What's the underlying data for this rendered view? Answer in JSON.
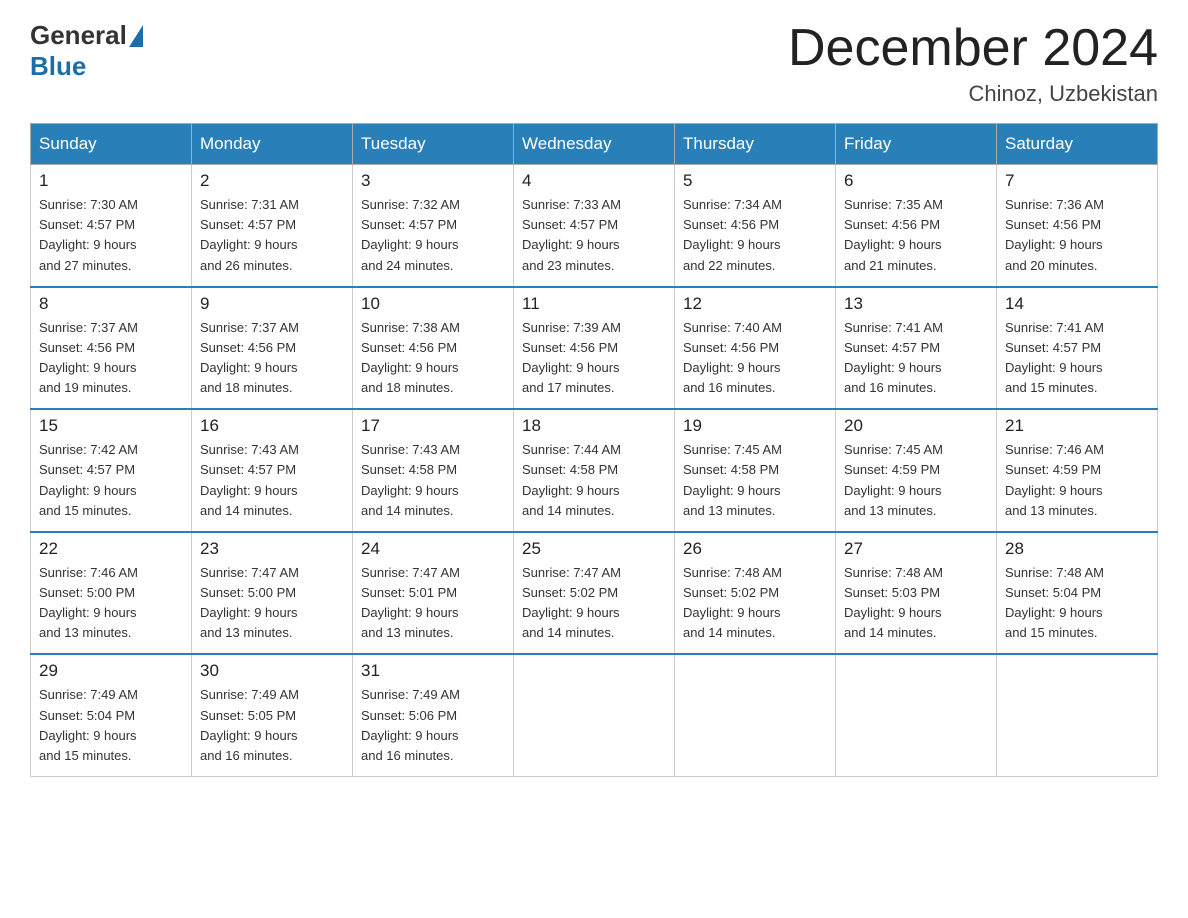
{
  "header": {
    "logo_general": "General",
    "logo_blue": "Blue",
    "title": "December 2024",
    "location": "Chinoz, Uzbekistan"
  },
  "days_of_week": [
    "Sunday",
    "Monday",
    "Tuesday",
    "Wednesday",
    "Thursday",
    "Friday",
    "Saturday"
  ],
  "weeks": [
    [
      {
        "day": "1",
        "sunrise": "7:30 AM",
        "sunset": "4:57 PM",
        "daylight": "9 hours and 27 minutes."
      },
      {
        "day": "2",
        "sunrise": "7:31 AM",
        "sunset": "4:57 PM",
        "daylight": "9 hours and 26 minutes."
      },
      {
        "day": "3",
        "sunrise": "7:32 AM",
        "sunset": "4:57 PM",
        "daylight": "9 hours and 24 minutes."
      },
      {
        "day": "4",
        "sunrise": "7:33 AM",
        "sunset": "4:57 PM",
        "daylight": "9 hours and 23 minutes."
      },
      {
        "day": "5",
        "sunrise": "7:34 AM",
        "sunset": "4:56 PM",
        "daylight": "9 hours and 22 minutes."
      },
      {
        "day": "6",
        "sunrise": "7:35 AM",
        "sunset": "4:56 PM",
        "daylight": "9 hours and 21 minutes."
      },
      {
        "day": "7",
        "sunrise": "7:36 AM",
        "sunset": "4:56 PM",
        "daylight": "9 hours and 20 minutes."
      }
    ],
    [
      {
        "day": "8",
        "sunrise": "7:37 AM",
        "sunset": "4:56 PM",
        "daylight": "9 hours and 19 minutes."
      },
      {
        "day": "9",
        "sunrise": "7:37 AM",
        "sunset": "4:56 PM",
        "daylight": "9 hours and 18 minutes."
      },
      {
        "day": "10",
        "sunrise": "7:38 AM",
        "sunset": "4:56 PM",
        "daylight": "9 hours and 18 minutes."
      },
      {
        "day": "11",
        "sunrise": "7:39 AM",
        "sunset": "4:56 PM",
        "daylight": "9 hours and 17 minutes."
      },
      {
        "day": "12",
        "sunrise": "7:40 AM",
        "sunset": "4:56 PM",
        "daylight": "9 hours and 16 minutes."
      },
      {
        "day": "13",
        "sunrise": "7:41 AM",
        "sunset": "4:57 PM",
        "daylight": "9 hours and 16 minutes."
      },
      {
        "day": "14",
        "sunrise": "7:41 AM",
        "sunset": "4:57 PM",
        "daylight": "9 hours and 15 minutes."
      }
    ],
    [
      {
        "day": "15",
        "sunrise": "7:42 AM",
        "sunset": "4:57 PM",
        "daylight": "9 hours and 15 minutes."
      },
      {
        "day": "16",
        "sunrise": "7:43 AM",
        "sunset": "4:57 PM",
        "daylight": "9 hours and 14 minutes."
      },
      {
        "day": "17",
        "sunrise": "7:43 AM",
        "sunset": "4:58 PM",
        "daylight": "9 hours and 14 minutes."
      },
      {
        "day": "18",
        "sunrise": "7:44 AM",
        "sunset": "4:58 PM",
        "daylight": "9 hours and 14 minutes."
      },
      {
        "day": "19",
        "sunrise": "7:45 AM",
        "sunset": "4:58 PM",
        "daylight": "9 hours and 13 minutes."
      },
      {
        "day": "20",
        "sunrise": "7:45 AM",
        "sunset": "4:59 PM",
        "daylight": "9 hours and 13 minutes."
      },
      {
        "day": "21",
        "sunrise": "7:46 AM",
        "sunset": "4:59 PM",
        "daylight": "9 hours and 13 minutes."
      }
    ],
    [
      {
        "day": "22",
        "sunrise": "7:46 AM",
        "sunset": "5:00 PM",
        "daylight": "9 hours and 13 minutes."
      },
      {
        "day": "23",
        "sunrise": "7:47 AM",
        "sunset": "5:00 PM",
        "daylight": "9 hours and 13 minutes."
      },
      {
        "day": "24",
        "sunrise": "7:47 AM",
        "sunset": "5:01 PM",
        "daylight": "9 hours and 13 minutes."
      },
      {
        "day": "25",
        "sunrise": "7:47 AM",
        "sunset": "5:02 PM",
        "daylight": "9 hours and 14 minutes."
      },
      {
        "day": "26",
        "sunrise": "7:48 AM",
        "sunset": "5:02 PM",
        "daylight": "9 hours and 14 minutes."
      },
      {
        "day": "27",
        "sunrise": "7:48 AM",
        "sunset": "5:03 PM",
        "daylight": "9 hours and 14 minutes."
      },
      {
        "day": "28",
        "sunrise": "7:48 AM",
        "sunset": "5:04 PM",
        "daylight": "9 hours and 15 minutes."
      }
    ],
    [
      {
        "day": "29",
        "sunrise": "7:49 AM",
        "sunset": "5:04 PM",
        "daylight": "9 hours and 15 minutes."
      },
      {
        "day": "30",
        "sunrise": "7:49 AM",
        "sunset": "5:05 PM",
        "daylight": "9 hours and 16 minutes."
      },
      {
        "day": "31",
        "sunrise": "7:49 AM",
        "sunset": "5:06 PM",
        "daylight": "9 hours and 16 minutes."
      },
      null,
      null,
      null,
      null
    ]
  ],
  "labels": {
    "sunrise": "Sunrise:",
    "sunset": "Sunset:",
    "daylight": "Daylight:"
  }
}
